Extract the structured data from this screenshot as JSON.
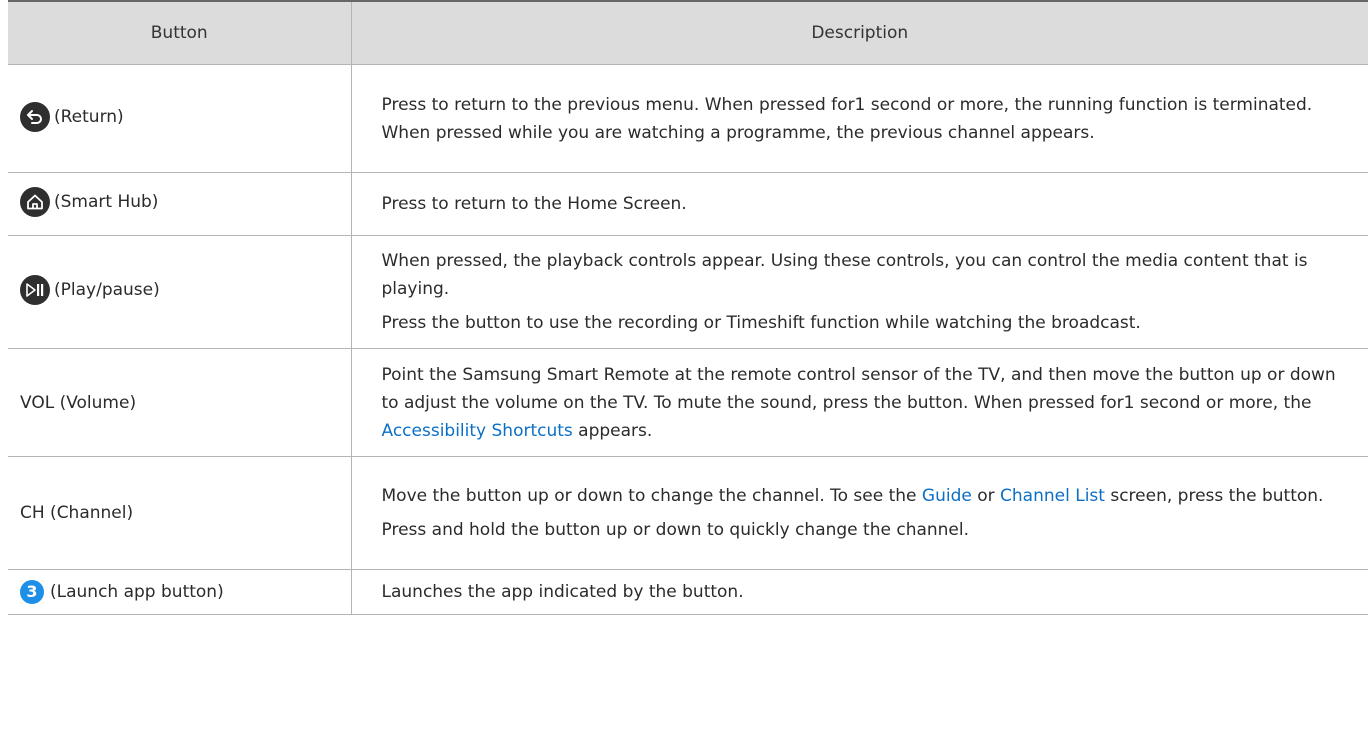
{
  "header": {
    "button_col": "Button",
    "description_col": "Description"
  },
  "rows": [
    {
      "icon": "return-icon",
      "label": "(Return)",
      "desc": [
        "Press to return to the previous menu. When pressed for1 second or more, the running function is terminated. When pressed while you are watching a programme, the previous channel appears."
      ]
    },
    {
      "icon": "home-icon",
      "label": "(Smart Hub)",
      "desc": [
        "Press to return to the Home Screen."
      ]
    },
    {
      "icon": "play-pause-icon",
      "label": "(Play/pause)",
      "desc": [
        "When pressed, the playback controls appear. Using these controls, you can control the media content that is playing.",
        "Press the button to use the recording or Timeshift function while watching the broadcast."
      ]
    },
    {
      "icon": "",
      "label": "VOL (Volume)",
      "desc_parts": {
        "p1_text": "Point the Samsung Smart Remote at the remote control sensor of the TV, and then move the button up or down to adjust the volume on the TV. To mute the sound, press the button. When pressed for1 second or more, the ",
        "p1_link": "Accessibility Shortcuts",
        "p1_tail": " appears."
      }
    },
    {
      "icon": "",
      "label": "CH (Channel)",
      "desc_parts": {
        "p1_text": "Move the button up or down to change the channel. To see the ",
        "p1_link1": "Guide",
        "p1_mid": " or ",
        "p1_link2": "Channel List",
        "p1_tail": " screen, press the button.",
        "p2": "Press and hold the button up or down to quickly change the channel."
      }
    },
    {
      "icon": "number-3-icon",
      "icon_text": "3",
      "label": "(Launch app button)",
      "desc": [
        "Launches the app indicated by the button."
      ]
    }
  ],
  "colors": {
    "header_bg": "#dcdcdc",
    "link": "#0b6fc6",
    "icon_dark": "#2f2f2f",
    "icon_blue": "#1d8fe6"
  }
}
